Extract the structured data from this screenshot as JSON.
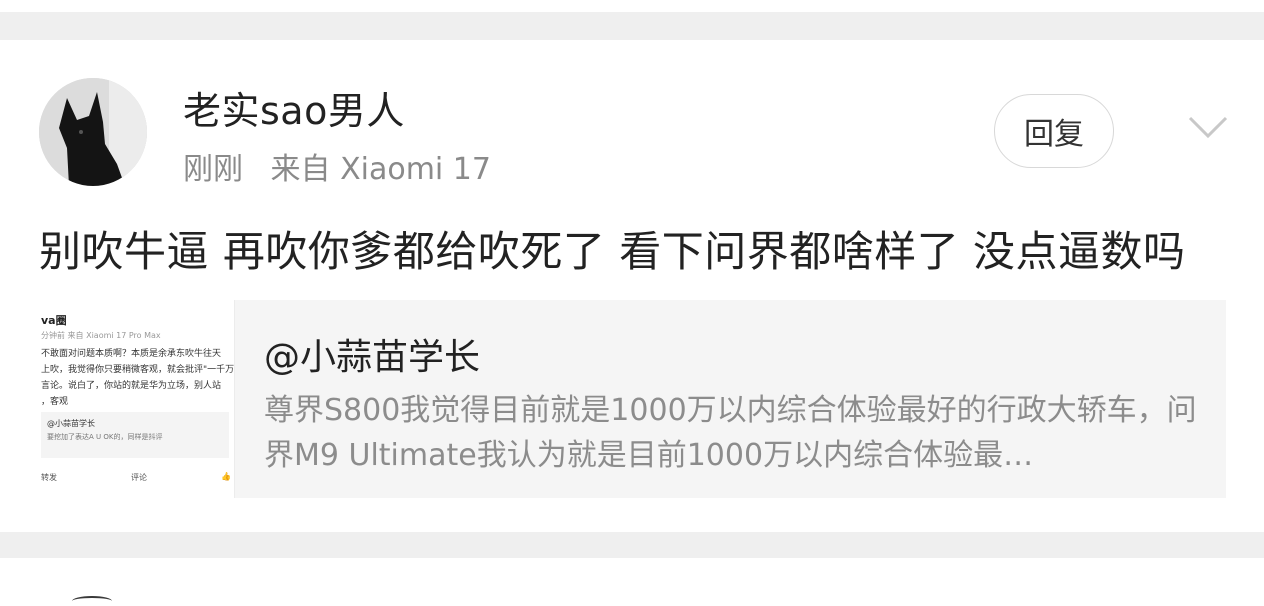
{
  "post": {
    "author": "老实sao男人",
    "time": "刚刚",
    "source": "来自 Xiaomi 17",
    "reply_label": "回复",
    "text": "别吹牛逼 再吹你爹都给吹死了 看下问界都啥样了 没点逼数吗"
  },
  "quote": {
    "author": "@小蒜苗学长",
    "body": "尊界S800我觉得目前就是1000万以内综合体验最好的行政大轿车，问界M9 Ultimate我认为就是目前1000万以内综合体验最…",
    "thumbnail": {
      "name": "va圈",
      "meta": "分钟前  来自 Xiaomi 17 Pro Max",
      "lines": [
        "不敢面对问题本质啊？本质是余承东吹牛往天",
        "上吹，我觉得你只要稍微客观，就会批评\"一千万",
        "言论。说白了，你站的就是华为立场，别人站",
        "，客观"
      ],
      "sub_name": "@小蒜苗学长",
      "sub_text": "要挖加了表达A U OK的，同样是抖评",
      "action_repost": "转发",
      "action_comment": "评论"
    }
  },
  "colors": {
    "background": "#ffffff",
    "separator": "#efefef",
    "text_primary": "#222222",
    "text_secondary": "#8a8a8a",
    "quote_background": "#f5f5f5"
  },
  "icons": {
    "avatar": "black-dog-avatar",
    "more": "chevron-down-icon"
  }
}
